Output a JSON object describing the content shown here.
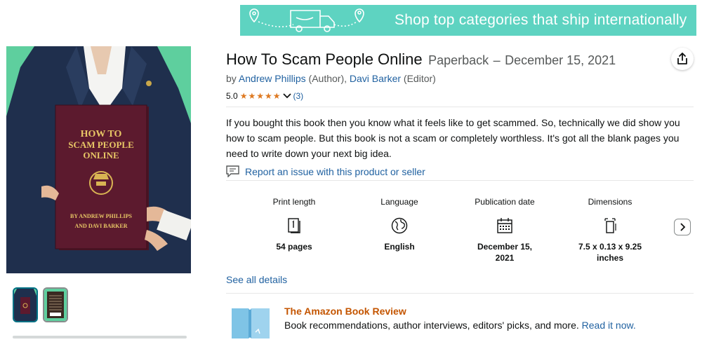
{
  "banner": {
    "text": "Shop top categories that ship internationally",
    "color": "#5ed3c1"
  },
  "product": {
    "title": "How To Scam People Online",
    "format": "Paperback",
    "date_separator": "–",
    "date": "December 15, 2021",
    "byline": {
      "by": "by",
      "author_name": "Andrew Phillips",
      "author_role": "(Author),",
      "editor_name": "Davi Barker",
      "editor_role": "(Editor)"
    },
    "rating": {
      "score": "5.0",
      "stars": 5,
      "count": "(3)",
      "star_color": "#de7921"
    },
    "description": "If you bought this book then you know what it feels like to get scammed. So, technically we did show you how to scam people. But this book is not a scam or completely worthless. It's got all the blank pages you need to write down your next big idea.",
    "report_link": "Report an issue with this product or seller"
  },
  "cover": {
    "line1": "HOW TO",
    "line2": "SCAM PEOPLE",
    "line3": "ONLINE",
    "author1": "BY ANDREW PHILLIPS",
    "author2": "AND DAVI BARKER"
  },
  "details": [
    {
      "label": "Print length",
      "icon": "book-pages-icon",
      "value": "54 pages"
    },
    {
      "label": "Language",
      "icon": "globe-icon",
      "value": "English"
    },
    {
      "label": "Publication date",
      "icon": "calendar-icon",
      "value": "December 15, 2021"
    },
    {
      "label": "Dimensions",
      "icon": "dimensions-icon",
      "value": "7.5 x 0.13 x 9.25 inches"
    }
  ],
  "see_all": "See all details",
  "book_review": {
    "title": "The Amazon Book Review",
    "text": "Book recommendations, author interviews, editors' picks, and more.",
    "link": "Read it now."
  },
  "colors": {
    "link": "#2162a1",
    "review_title": "#c45500",
    "image_bg": "#5ecf9e",
    "book_cover": "#5c1a2e"
  }
}
